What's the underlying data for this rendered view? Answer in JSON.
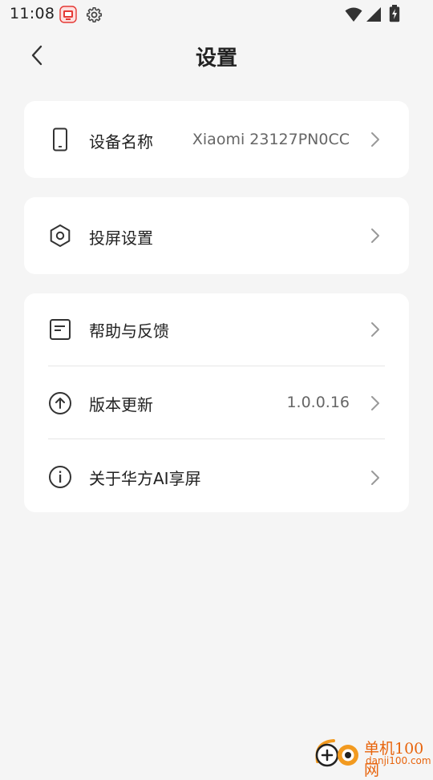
{
  "status_bar": {
    "time": "11:08",
    "icons": [
      "cast-app-icon",
      "gear-icon",
      "wifi-icon",
      "signal-icon",
      "battery-charging-icon"
    ]
  },
  "header": {
    "title": "设置",
    "back_icon": "chevron-left-icon"
  },
  "sections": [
    {
      "items": [
        {
          "icon": "phone-icon",
          "label": "设备名称",
          "value": "Xiaomi 23127PN0CC"
        }
      ]
    },
    {
      "items": [
        {
          "icon": "hexagon-settings-icon",
          "label": "投屏设置",
          "value": ""
        }
      ]
    },
    {
      "items": [
        {
          "icon": "document-icon",
          "label": "帮助与反馈",
          "value": ""
        },
        {
          "icon": "arrow-up-circle-icon",
          "label": "版本更新",
          "value": "1.0.0.16"
        },
        {
          "icon": "info-circle-icon",
          "label": "关于华方AI享屏",
          "value": ""
        }
      ]
    }
  ],
  "watermark": {
    "name": "单机100网",
    "url": "danji100.com"
  },
  "colors": {
    "background": "#f5f5f5",
    "card": "#ffffff",
    "text_primary": "#222222",
    "text_secondary": "#666666",
    "chevron": "#999999",
    "status_app_red": "#e53935",
    "watermark_orange": "#e8640c"
  }
}
